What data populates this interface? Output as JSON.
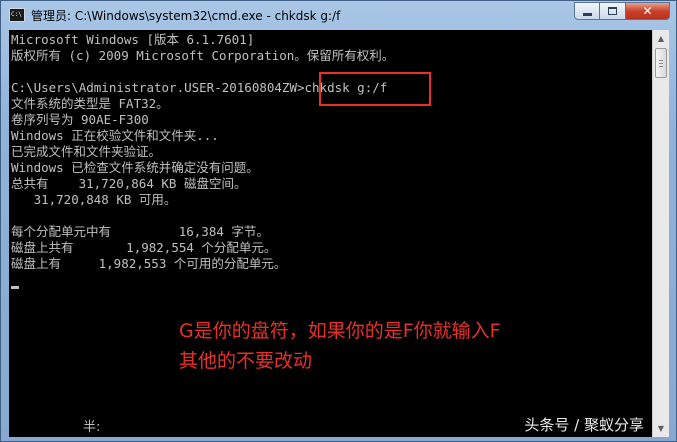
{
  "window": {
    "title": "管理员: C:\\Windows\\system32\\cmd.exe - chkdsk  g:/f",
    "icon_text": "C:\\"
  },
  "console": {
    "lines": [
      "Microsoft Windows [版本 6.1.7601]",
      "版权所有 (c) 2009 Microsoft Corporation。保留所有权利。",
      "",
      "C:\\Users\\Administrator.USER-20160804ZW>chkdsk g:/f",
      "文件系统的类型是 FAT32。",
      "卷序列号为 90AE-F300",
      "Windows 正在校验文件和文件夹...",
      "已完成文件和文件夹验证。",
      "Windows 已检查文件系统并确定没有问题。",
      "总共有    31,720,864 KB 磁盘空间。",
      "   31,720,848 KB 可用。",
      "",
      "每个分配单元中有         16,384 字节。",
      "磁盘上共有       1,982,554 个分配单元。",
      "磁盘上有     1,982,553 个可用的分配单元。"
    ],
    "ime_status": "半:"
  },
  "annotation": {
    "line1": "G是你的盘符，如果你的是F你就输入F",
    "line2": "其他的不要改动",
    "color": "#e8302b"
  },
  "watermark": "头条号 / 聚蚁分享",
  "colors": {
    "console_bg": "#000000",
    "console_text": "#c0c0c0",
    "highlight": "#e8302b"
  }
}
